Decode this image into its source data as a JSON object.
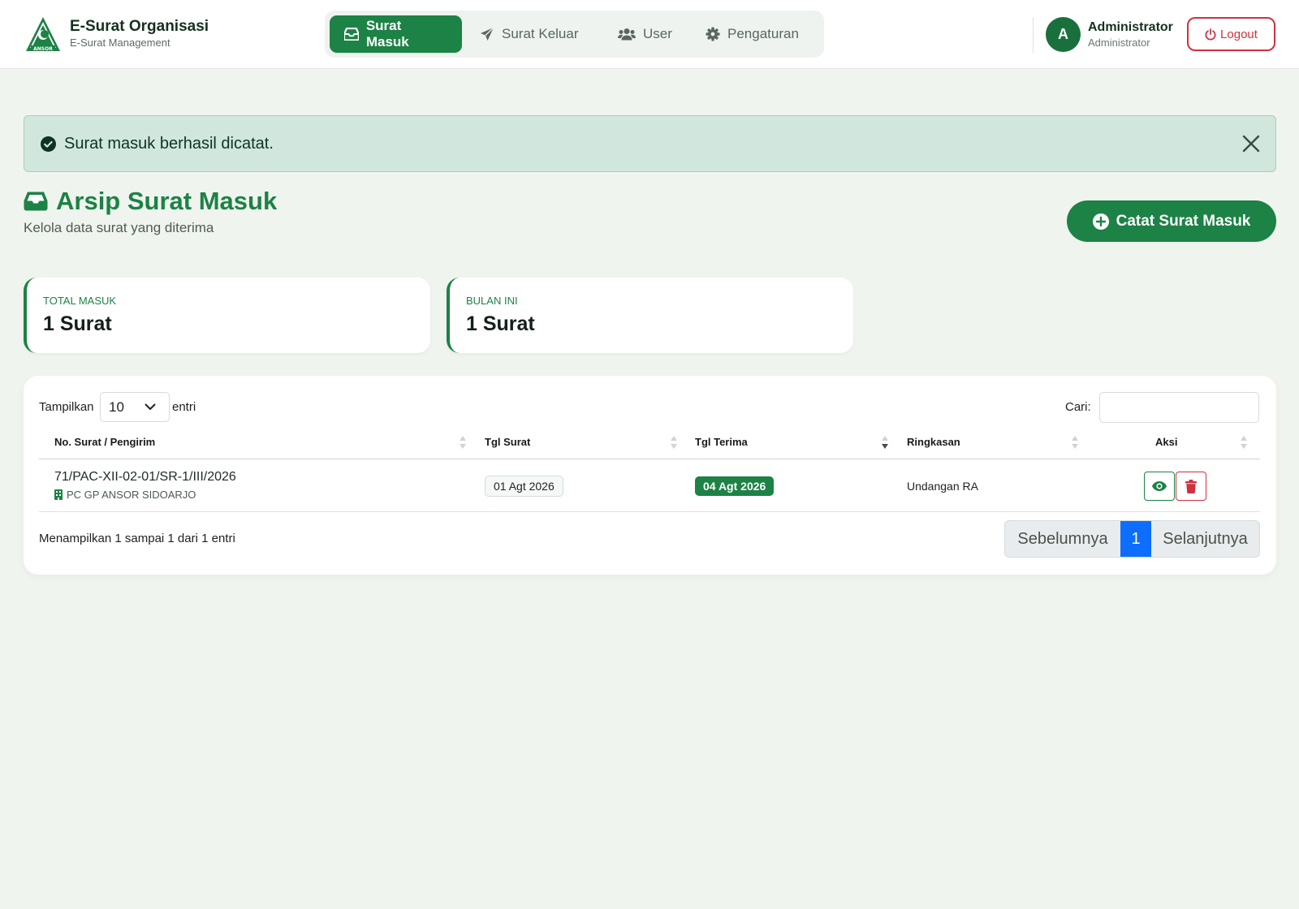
{
  "brand": {
    "title": "E-Surat Organisasi",
    "subtitle": "E-Surat Management",
    "logo_text": "ANSOR"
  },
  "nav": {
    "items": [
      {
        "label": "Surat Masuk",
        "icon": "inbox-icon",
        "active": true
      },
      {
        "label": "Surat Keluar",
        "icon": "paper-plane-icon",
        "active": false
      },
      {
        "label": "User",
        "icon": "users-icon",
        "active": false
      },
      {
        "label": "Pengaturan",
        "icon": "gear-icon",
        "active": false
      }
    ]
  },
  "user": {
    "initial": "A",
    "name": "Administrator",
    "role": "Administrator",
    "logout_label": "Logout"
  },
  "alert": {
    "message": "Surat masuk berhasil dicatat."
  },
  "page": {
    "title": "Arsip Surat Masuk",
    "subtitle": "Kelola data surat yang diterima",
    "add_button": "Catat Surat Masuk"
  },
  "stats": [
    {
      "label": "TOTAL MASUK",
      "value": "1 Surat"
    },
    {
      "label": "BULAN INI",
      "value": "1 Surat"
    }
  ],
  "table": {
    "length_label": "Tampilkan",
    "length_value": "10",
    "length_suffix": "entri",
    "search_label": "Cari:",
    "search_value": "",
    "columns": [
      "No. Surat / Pengirim",
      "Tgl Surat",
      "Tgl Terima",
      "Ringkasan",
      "Aksi"
    ],
    "rows": [
      {
        "no": "71/PAC-XII-02-01/SR-1/III/2026",
        "sender": "PC GP ANSOR SIDOARJO",
        "tgl_surat": "01 Agt 2026",
        "tgl_terima": "04 Agt 2026",
        "ringkasan": "Undangan RA"
      }
    ],
    "info": "Menampilkan 1 sampai 1 dari 1 entri",
    "pagination": {
      "prev": "Sebelumnya",
      "current": "1",
      "next": "Selanjutnya"
    }
  },
  "colors": {
    "primary": "#1c8245",
    "danger": "#d0303f",
    "page_bg": "#f0f4ef",
    "alert_bg": "#d1e7dd",
    "pager_active": "#0d6efd"
  }
}
